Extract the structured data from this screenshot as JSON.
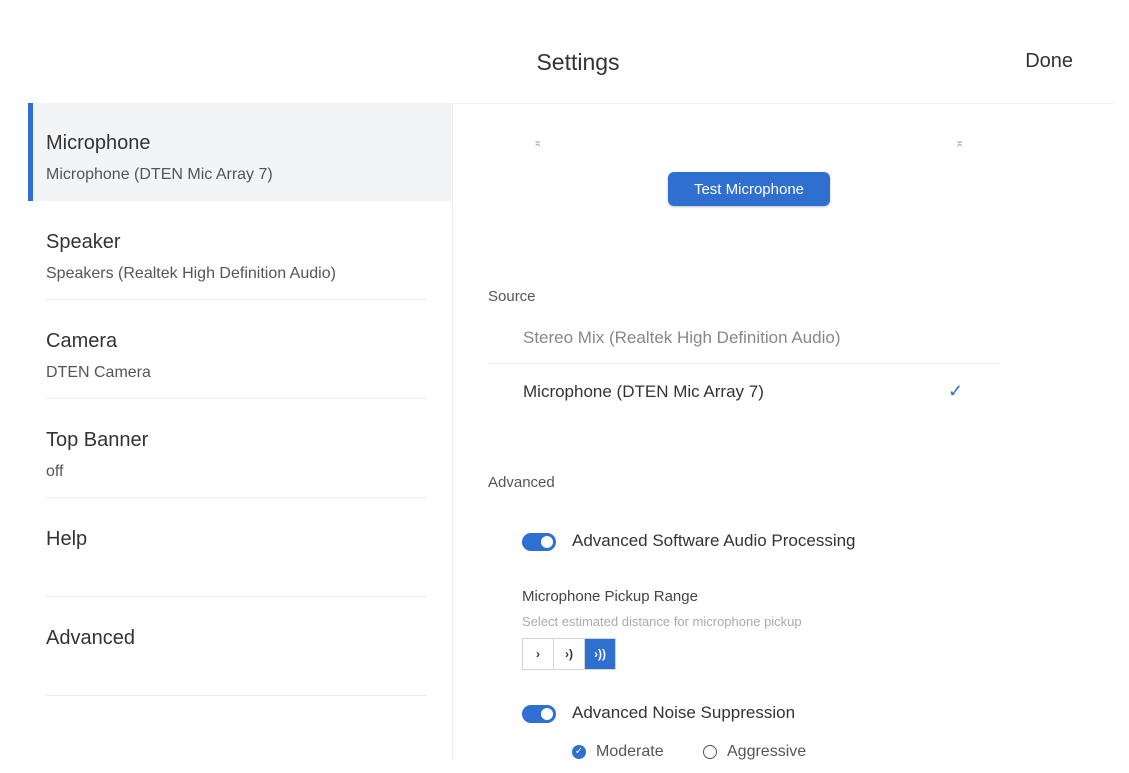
{
  "header": {
    "title": "Settings",
    "done_label": "Done"
  },
  "sidebar": {
    "items": [
      {
        "label": "Microphone",
        "value": "Microphone (DTEN Mic Array 7)",
        "active": true
      },
      {
        "label": "Speaker",
        "value": "Speakers (Realtek High Definition Audio)"
      },
      {
        "label": "Camera",
        "value": "DTEN Camera"
      },
      {
        "label": "Top Banner",
        "value": "off"
      },
      {
        "label": "Help",
        "value": ""
      },
      {
        "label": "Advanced",
        "value": ""
      }
    ]
  },
  "main": {
    "test_button_label": "Test Microphone",
    "source": {
      "heading": "Source",
      "options": [
        {
          "label": "Stereo Mix (Realtek High Definition Audio)",
          "selected": false
        },
        {
          "label": "Microphone (DTEN Mic Array 7)",
          "selected": true
        }
      ],
      "check_icon": "✓"
    },
    "advanced": {
      "heading": "Advanced",
      "audio_processing": {
        "label": "Advanced Software Audio Processing",
        "enabled": true
      },
      "pickup_range": {
        "title": "Microphone Pickup Range",
        "subtitle": "Select estimated distance for microphone pickup",
        "levels": [
          "›",
          "›)",
          "›))"
        ],
        "selected_index": 2
      },
      "noise_suppression": {
        "label": "Advanced Noise Suppression",
        "enabled": true
      },
      "suppression_levels": [
        {
          "label": "Moderate",
          "selected": true
        },
        {
          "label": "Aggressive",
          "selected": false
        }
      ]
    }
  },
  "colors": {
    "accent": "#2f6fd0",
    "active_bg": "#f3f4f6"
  }
}
